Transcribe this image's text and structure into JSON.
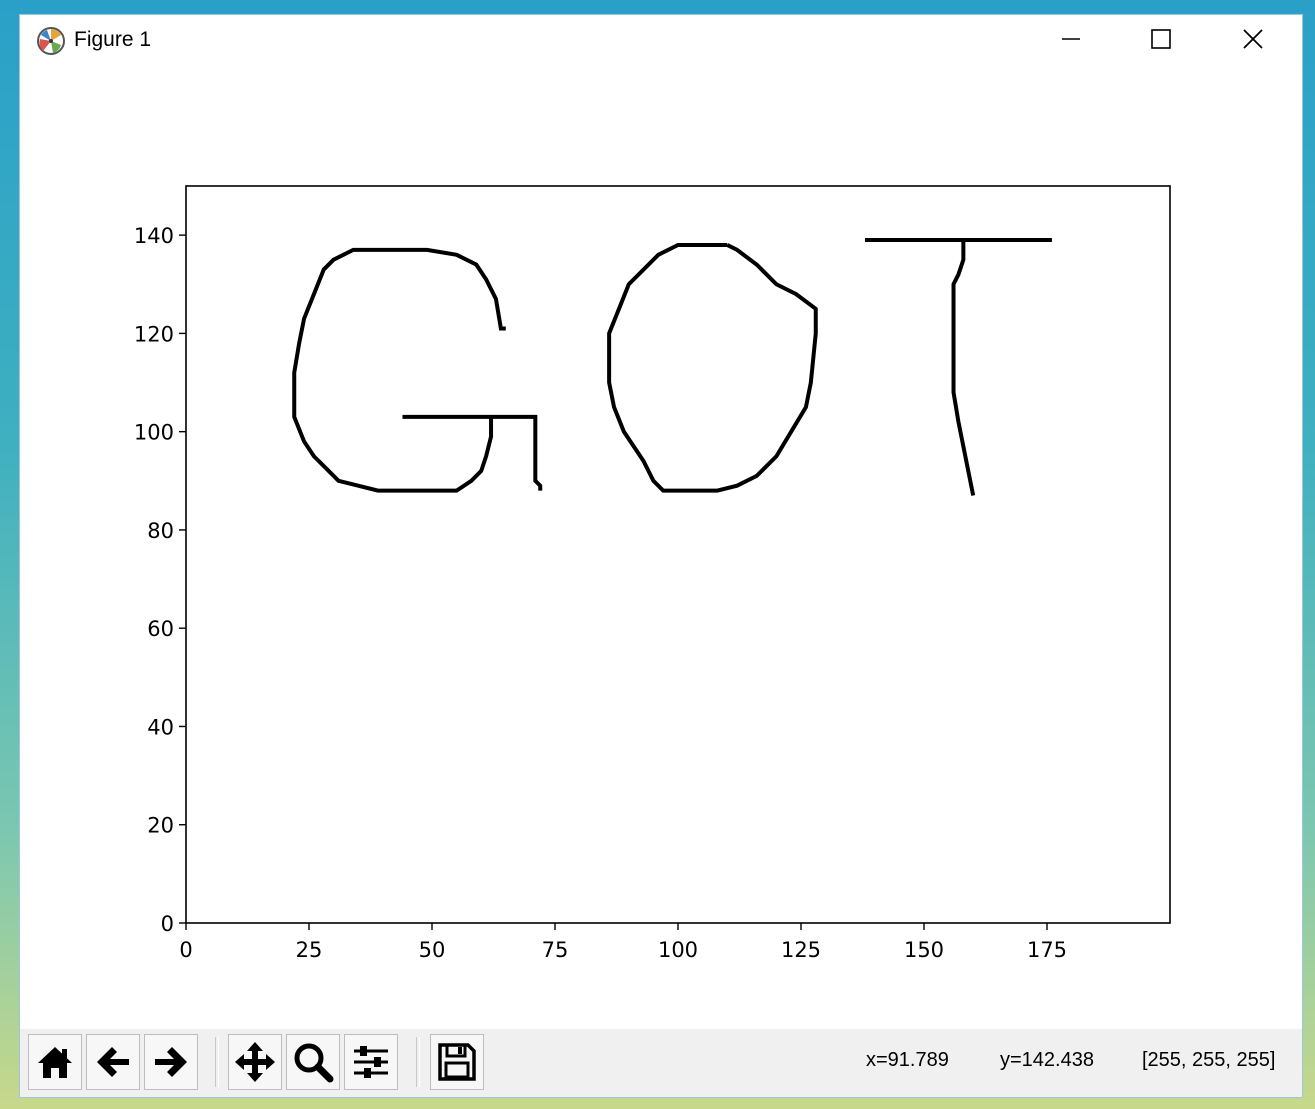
{
  "window": {
    "title": "Figure 1",
    "controls": {
      "minimize": "minimize",
      "maximize": "maximize",
      "close": "close"
    }
  },
  "toolbar": {
    "buttons": [
      {
        "name": "home",
        "icon": "home-icon"
      },
      {
        "name": "back",
        "icon": "arrow-left-icon"
      },
      {
        "name": "forward",
        "icon": "arrow-right-icon"
      },
      {
        "name": "pan",
        "icon": "move-icon"
      },
      {
        "name": "zoom",
        "icon": "magnifier-icon"
      },
      {
        "name": "configure-subplots",
        "icon": "sliders-icon"
      },
      {
        "name": "save",
        "icon": "floppy-disk-icon"
      }
    ]
  },
  "status": {
    "x": "x=91.789",
    "y": "y=142.438",
    "pixel": "[255, 255, 255]"
  },
  "chart_data": {
    "type": "image",
    "description_text": "GOT",
    "xlim": [
      0,
      200
    ],
    "ylim": [
      0,
      150
    ],
    "xticks": [
      "0",
      "25",
      "50",
      "75",
      "100",
      "125",
      "150",
      "175"
    ],
    "yticks": [
      "0",
      "20",
      "40",
      "60",
      "80",
      "100",
      "120",
      "140"
    ],
    "grid": false,
    "strokes": [
      {
        "name": "letter-G-arc",
        "points": [
          [
            65,
            121
          ],
          [
            64,
            121
          ],
          [
            63,
            127
          ],
          [
            61,
            131
          ],
          [
            59,
            134
          ],
          [
            55,
            136
          ],
          [
            49,
            137
          ],
          [
            34,
            137
          ],
          [
            30,
            135
          ],
          [
            28,
            133
          ],
          [
            26,
            128
          ],
          [
            24,
            123
          ],
          [
            23,
            118
          ],
          [
            22,
            112
          ],
          [
            22,
            103
          ],
          [
            24,
            98
          ],
          [
            26,
            95
          ],
          [
            29,
            92
          ],
          [
            31,
            90
          ],
          [
            35,
            89
          ],
          [
            39,
            88
          ],
          [
            55,
            88
          ],
          [
            58,
            90
          ],
          [
            60,
            92
          ],
          [
            61,
            95
          ],
          [
            62,
            99
          ],
          [
            62,
            103
          ]
        ]
      },
      {
        "name": "letter-G-bar",
        "points": [
          [
            44,
            103
          ],
          [
            71,
            103
          ],
          [
            71,
            90
          ],
          [
            72,
            89
          ],
          [
            72,
            88
          ]
        ]
      },
      {
        "name": "letter-O",
        "points": [
          [
            110,
            138
          ],
          [
            107,
            138
          ],
          [
            100,
            138
          ],
          [
            96,
            136
          ],
          [
            93,
            133
          ],
          [
            90,
            130
          ],
          [
            88,
            125
          ],
          [
            86,
            120
          ],
          [
            86,
            110
          ],
          [
            87,
            105
          ],
          [
            89,
            100
          ],
          [
            91,
            97
          ],
          [
            93,
            94
          ],
          [
            95,
            90
          ],
          [
            97,
            88
          ],
          [
            102,
            88
          ],
          [
            108,
            88
          ],
          [
            112,
            89
          ],
          [
            116,
            91
          ],
          [
            120,
            95
          ],
          [
            123,
            100
          ],
          [
            126,
            105
          ],
          [
            127,
            110
          ],
          [
            128,
            120
          ],
          [
            128,
            125
          ],
          [
            124,
            128
          ],
          [
            120,
            130
          ],
          [
            116,
            134
          ],
          [
            112,
            137
          ],
          [
            110,
            138
          ]
        ]
      },
      {
        "name": "letter-T-bar",
        "points": [
          [
            138,
            139
          ],
          [
            176,
            139
          ]
        ]
      },
      {
        "name": "letter-T-stem",
        "points": [
          [
            158,
            139
          ],
          [
            158,
            135
          ],
          [
            157,
            132
          ],
          [
            156,
            130
          ],
          [
            156,
            108
          ],
          [
            157,
            102
          ],
          [
            158,
            97
          ],
          [
            159,
            92
          ],
          [
            160,
            87
          ]
        ]
      }
    ]
  }
}
